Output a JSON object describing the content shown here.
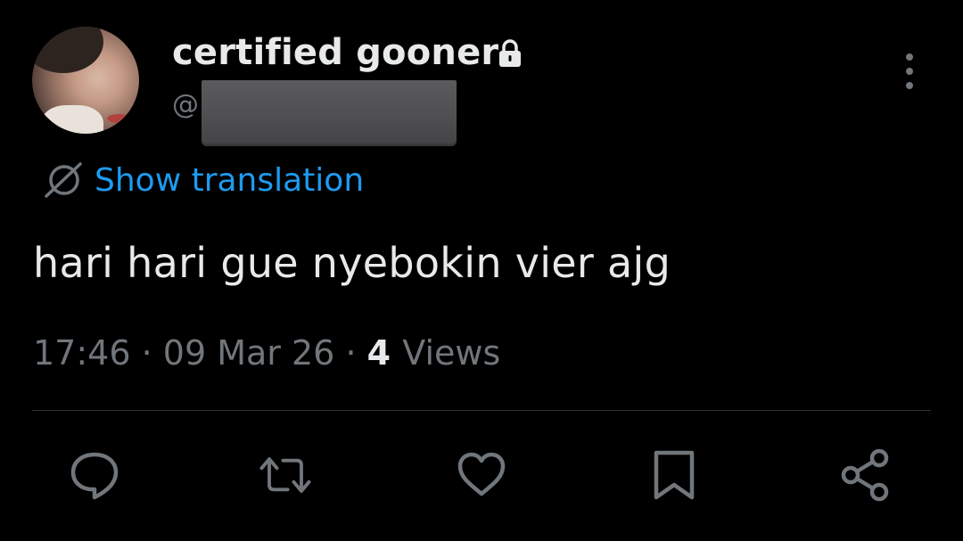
{
  "tweet": {
    "display_name": "certified gooner",
    "handle_prefix": "@",
    "translate_label": "Show translation",
    "text": "hari hari gue nyebokin vier ajg",
    "time": "17:46",
    "separator": "·",
    "date": "09 Mar 26",
    "views_count": "4",
    "views_label": "Views"
  },
  "icons": {
    "lock": "lock-icon",
    "more": "more-vertical-icon",
    "translate": "globe-icon",
    "reply": "reply-icon",
    "retweet": "retweet-icon",
    "like": "heart-icon",
    "bookmark": "bookmark-icon",
    "share": "share-icon"
  },
  "colors": {
    "background": "#000000",
    "text_primary": "#e7e9ea",
    "text_secondary": "#71767b",
    "accent": "#1d9bf0",
    "divider": "#2f3336"
  }
}
